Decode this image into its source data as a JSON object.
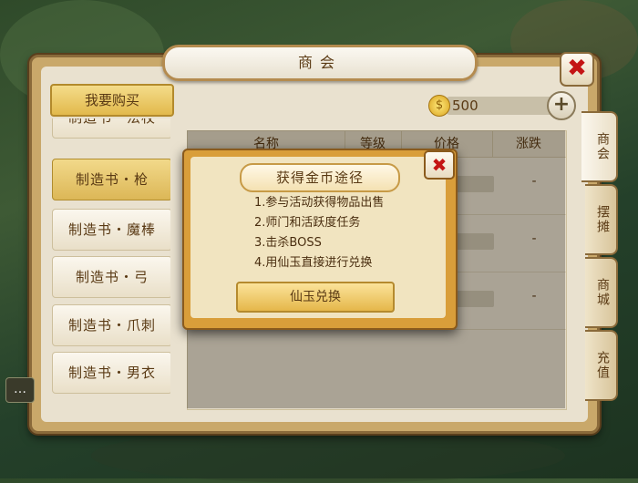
{
  "window": {
    "title": "商会"
  },
  "toolbar": {
    "buy_label": "我要购买",
    "gold_amount": "500",
    "coin_glyph": "$",
    "plus": "+"
  },
  "list": {
    "items": [
      {
        "label": "制造书・法杖"
      },
      {
        "label": "制造书・枪"
      },
      {
        "label": "制造书・魔棒"
      },
      {
        "label": "制造书・弓"
      },
      {
        "label": "制造书・爪刺"
      },
      {
        "label": "制造书・男衣"
      }
    ]
  },
  "table": {
    "headers": [
      "名称",
      "等级",
      "价格",
      "涨跌"
    ],
    "rows": [
      {
        "change": "-"
      },
      {
        "change": "-"
      },
      {
        "change": "-"
      }
    ]
  },
  "tabs": [
    {
      "label": "商会"
    },
    {
      "label": "摆摊"
    },
    {
      "label": "商城"
    },
    {
      "label": "充值"
    }
  ],
  "popup": {
    "title": "获得金币途径",
    "lines": [
      "1.参与活动获得物品出售",
      "2.师门和活跃度任务",
      "3.击杀BOSS",
      "4.用仙玉直接进行兑换"
    ],
    "button_label": "仙玉兑换",
    "close_glyph": "✖"
  },
  "close_glyph": "✖",
  "chat_glyph": "…"
}
